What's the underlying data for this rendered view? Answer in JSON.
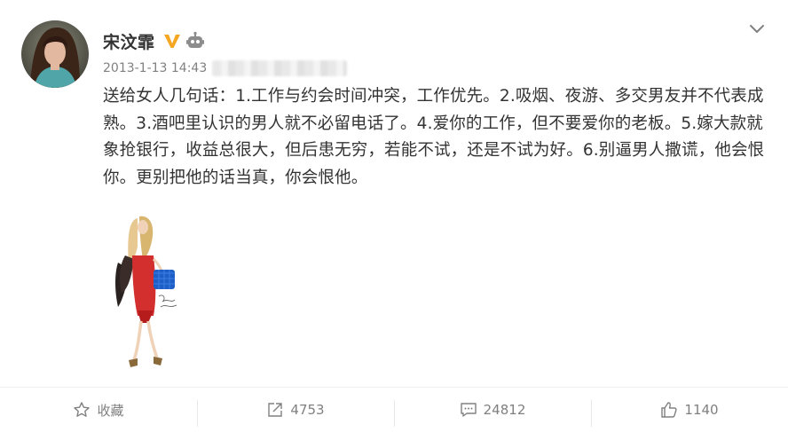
{
  "post": {
    "author": "宋汶霏",
    "timestamp": "2013-1-13 14:43",
    "text": "送给女人几句话：1.工作与约会时间冲突，工作优先。2.吸烟、夜游、多交男友并不代表成熟。3.酒吧里认识的男人就不必留电话了。4.爱你的工作，但不要爱你的老板。5.嫁大款就象抢银行，收益总很大，但后患无穷，若能不试，还是不试为好。6.别逼男人撒谎，他会恨你。更别把他的话当真，你会恨他。"
  },
  "badges": {
    "verified": "vip-icon",
    "robot": "robot-icon",
    "vip_color": "#f5a623"
  },
  "actions": {
    "favorite_label": "收藏",
    "repost_count": "4753",
    "comment_count": "24812",
    "like_count": "1140"
  },
  "icons": [
    "chevron-down-icon",
    "star-icon",
    "share-icon",
    "comment-icon",
    "thumbs-up-icon"
  ],
  "colors": {
    "text": "#333333",
    "muted": "#808080",
    "dress": "#d32f2f",
    "bag": "#1e5fc7"
  }
}
